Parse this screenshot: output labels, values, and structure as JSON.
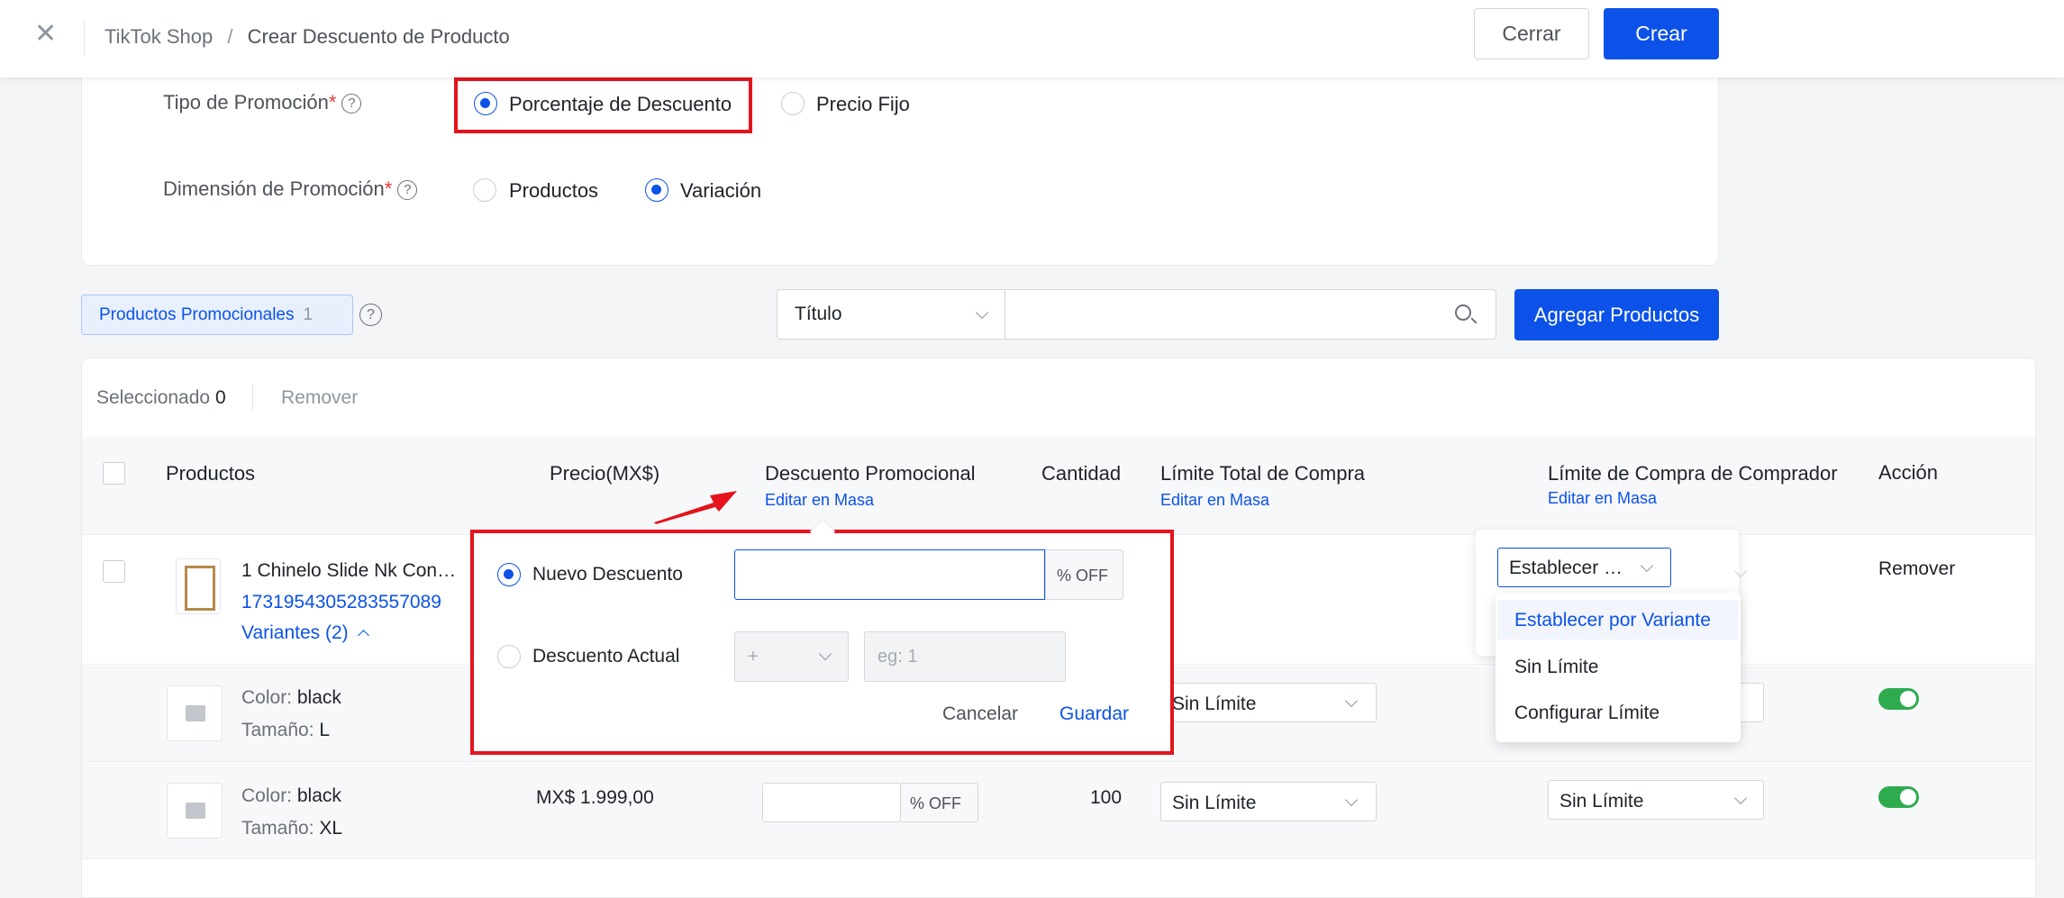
{
  "header": {
    "breadcrumb_root": "TikTok Shop",
    "breadcrumb_separator": "/",
    "breadcrumb_current": "Crear Descuento de Producto",
    "cancel_label": "Cerrar",
    "create_label": "Crear"
  },
  "promo_settings": {
    "type_label": "Tipo de Promoción",
    "type_options": [
      "Porcentaje de Descuento",
      "Precio Fijo"
    ],
    "type_selected": "Porcentaje de Descuento",
    "dimension_label": "Dimensión de Promoción",
    "dimension_options": [
      "Productos",
      "Variación"
    ],
    "dimension_selected": "Variación",
    "required_mark": "*",
    "help_glyph": "?"
  },
  "filter": {
    "tag_label": "Productos Promocionales",
    "tag_count": "1",
    "field_select": "Título",
    "search_placeholder": "",
    "add_button": "Agregar Productos"
  },
  "selection": {
    "selected_label": "Seleccionado",
    "selected_count": "0",
    "remove_label": "Remover"
  },
  "table": {
    "columns": {
      "products": "Productos",
      "price": "Precio(MX$)",
      "discount": "Descuento Promocional",
      "quantity": "Cantidad",
      "total_limit": "Límite Total de Compra",
      "buyer_limit": "Límite de Compra de Comprador",
      "action": "Acción"
    },
    "bulk_edit_label": "Editar en Masa",
    "product": {
      "name": "1 Chinelo Slide Nk Con…",
      "id": "1731954305283557089",
      "variants_toggle": "Variantes (2)",
      "action": "Remover"
    },
    "variants": [
      {
        "color_label": "Color:",
        "color": "black",
        "size_label": "Tamaño:",
        "size": "L",
        "price": "",
        "discount": "",
        "discount_suffix": "% OFF",
        "quantity": "",
        "total_limit": "Sin Límite",
        "buyer_limit": "",
        "enabled": true
      },
      {
        "color_label": "Color:",
        "color": "black",
        "size_label": "Tamaño:",
        "size": "XL",
        "price": "MX$ 1.999,00",
        "discount": "",
        "discount_suffix": "% OFF",
        "quantity": "100",
        "total_limit": "Sin Límite",
        "buyer_limit": "Sin Límite",
        "enabled": true
      }
    ]
  },
  "bulk_popover": {
    "option_new": "Nuevo Descuento",
    "option_current": "Descuento Actual",
    "selected": "Nuevo Descuento",
    "new_value": "",
    "suffix": "% OFF",
    "operator": "+",
    "current_placeholder": "eg: 1",
    "cancel": "Cancelar",
    "save": "Guardar"
  },
  "buyer_limit_dropdown": {
    "current": "Establecer …",
    "options": [
      "Establecer por Variante",
      "Sin Límite",
      "Configurar Límite"
    ],
    "highlighted": "Establecer por Variante"
  },
  "colors": {
    "primary": "#0c52e8",
    "highlight_box": "#e3141d",
    "toggle_on": "#2fab4f"
  },
  "icons": [
    "close-icon",
    "help-icon",
    "search-icon",
    "chevron-down-icon",
    "chevron-up-icon",
    "image-placeholder-icon",
    "arrow-icon"
  ]
}
